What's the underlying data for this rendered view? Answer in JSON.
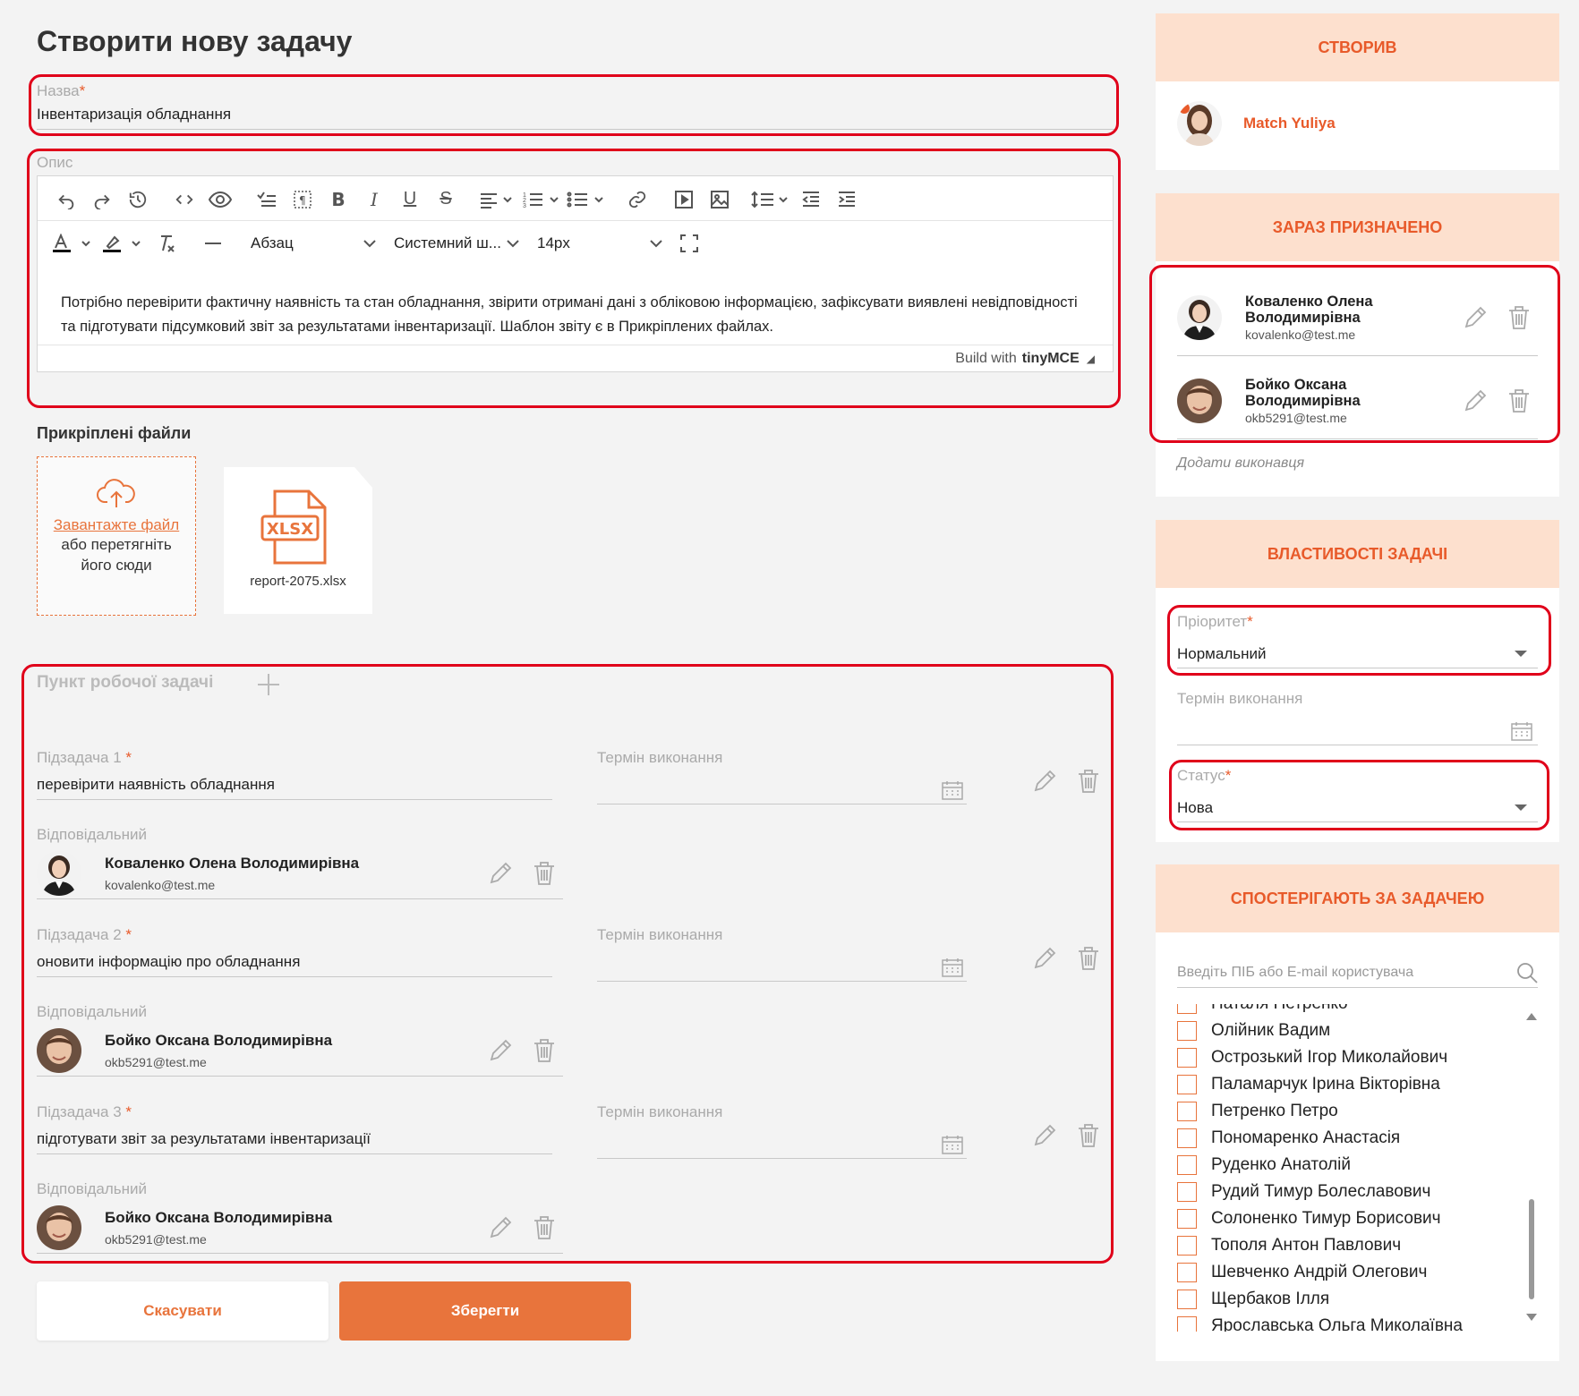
{
  "page": {
    "title": "Створити нову задачу"
  },
  "task": {
    "name_label": "Назва",
    "name_value": "Інвентаризація обладнання",
    "desc_label": "Опис",
    "description": "Потрібно перевірити фактичну наявність та стан обладнання, звірити отримані дані з обліковою інформацією, зафіксувати виявлені невідповідності та підготувати підсумковий звіт за результатами інвентаризації. Шаблон звіту є в Прикріплених файлах."
  },
  "editor": {
    "block_format": "Абзац",
    "font_family": "Системний ш...",
    "font_size": "14px",
    "status_prefix": "Build with",
    "status_brand": "tinyMCE"
  },
  "attachments": {
    "title": "Прикріплені файли",
    "upload_link": "Завантажте файл",
    "upload_line1": "або перетягніть",
    "upload_line2": "його сюди",
    "file_ext": "XLSX",
    "file_name": "report-2075.xlsx"
  },
  "workpoints": {
    "title": "Пункт робочої задачі",
    "due_label": "Термін виконання",
    "resp_label": "Відповідальний",
    "items": [
      {
        "label": "Підзадача 1",
        "value": "перевірити наявність обладнання",
        "person": "Коваленко Олена Володимирівна",
        "email": "kovalenko@test.me"
      },
      {
        "label": "Підзадача 2",
        "value": "оновити інформацію про обладнання",
        "person": "Бойко Оксана Володимирівна",
        "email": "okb5291@test.me"
      },
      {
        "label": "Підзадача 3",
        "value": "підготувати звіт за результатами інвентаризації",
        "person": "Бойко Оксана Володимирівна",
        "email": "okb5291@test.me"
      }
    ]
  },
  "buttons": {
    "cancel": "Скасувати",
    "save": "Зберегти"
  },
  "creator": {
    "header": "Створив",
    "name": "Match Yuliya"
  },
  "assigned": {
    "header": "Зараз призначено",
    "people": [
      {
        "name_line1": "Коваленко Олена",
        "name_line2": "Володимирівна",
        "email": "kovalenko@test.me"
      },
      {
        "name_line1": "Бойко Оксана",
        "name_line2": "Володимирівна",
        "email": "okb5291@test.me"
      }
    ],
    "add_label": "Додати виконавця"
  },
  "properties": {
    "header": "Властивості задачі",
    "priority_label": "Пріоритет",
    "priority_value": "Нормальний",
    "due_label": "Термін виконання",
    "status_label": "Статус",
    "status_value": "Нова"
  },
  "watchers": {
    "header": "Спостерігають за задачею",
    "search_placeholder": "Введіть ПІБ або E-mail користувача",
    "items": [
      "Наталя Петренко",
      "Олійник Вадим",
      "Острозький Ігор Миколайович",
      "Паламарчук Ірина Вікторівна",
      "Петренко Петро",
      "Пономаренко Анастасія",
      "Руденко Анатолій",
      "Рудий Тимур Болеславович",
      "Солоненко Тимур Борисович",
      "Тополя Антон Павлович",
      "Шевченко Андрій Олегович",
      "Щербаков Ілля",
      "Ярославська Ольга Миколаївна"
    ]
  },
  "colors": {
    "accent": "#e8743c",
    "accent_dark": "#e85a2a",
    "header_bg": "#fde0ce",
    "highlight": "#e0001a"
  }
}
